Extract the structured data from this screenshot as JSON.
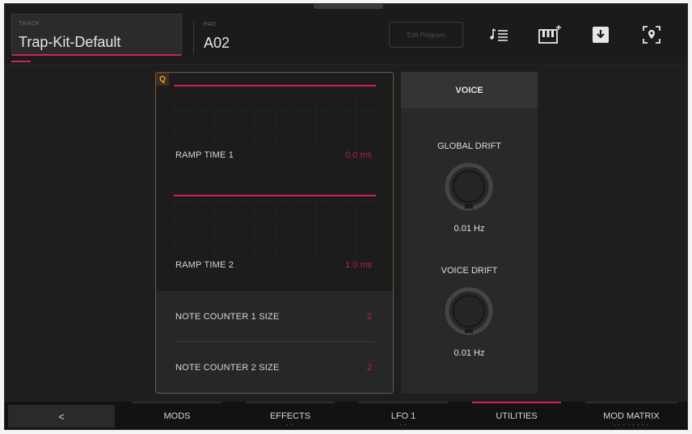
{
  "header": {
    "track_caption": "TRACK",
    "track_value": "Trap-Kit-Default",
    "pad_caption": "PAD",
    "pad_value": "A02",
    "ghost_button_label": "Edit Program",
    "icons": [
      "note-list-icon",
      "keyboard-add-icon",
      "download-icon",
      "location-pin-icon"
    ]
  },
  "quantize_panel": {
    "badge": "Q",
    "ramp_time_1": {
      "label": "RAMP TIME 1",
      "value": "0.0 ms"
    },
    "ramp_time_2": {
      "label": "RAMP TIME 2",
      "value": "1.0 ms"
    },
    "note_counter_1": {
      "label": "NOTE COUNTER 1 SIZE",
      "value": "2"
    },
    "note_counter_2": {
      "label": "NOTE COUNTER 2 SIZE",
      "value": "2"
    }
  },
  "voice_panel": {
    "title": "VOICE",
    "global_drift": {
      "label": "GLOBAL DRIFT",
      "value": "0.01 Hz"
    },
    "voice_drift": {
      "label": "VOICE DRIFT",
      "value": "0.01 Hz"
    }
  },
  "bottom_bar": {
    "back_label": "<",
    "tabs": [
      {
        "label": "MODS",
        "active": false,
        "dots": ""
      },
      {
        "label": "EFFECTS",
        "active": false,
        "dots": "• •"
      },
      {
        "label": "LFO 1",
        "active": false,
        "dots": "• •"
      },
      {
        "label": "UTILITIES",
        "active": true,
        "dots": ""
      },
      {
        "label": "MOD MATRIX",
        "active": false,
        "dots": "• • • • • • • •"
      }
    ]
  },
  "colors": {
    "accent": "#d3224f",
    "quantize_border": "#7a5a3a",
    "quantize_badge": "#f0a030",
    "value_red": "#b8203f"
  }
}
